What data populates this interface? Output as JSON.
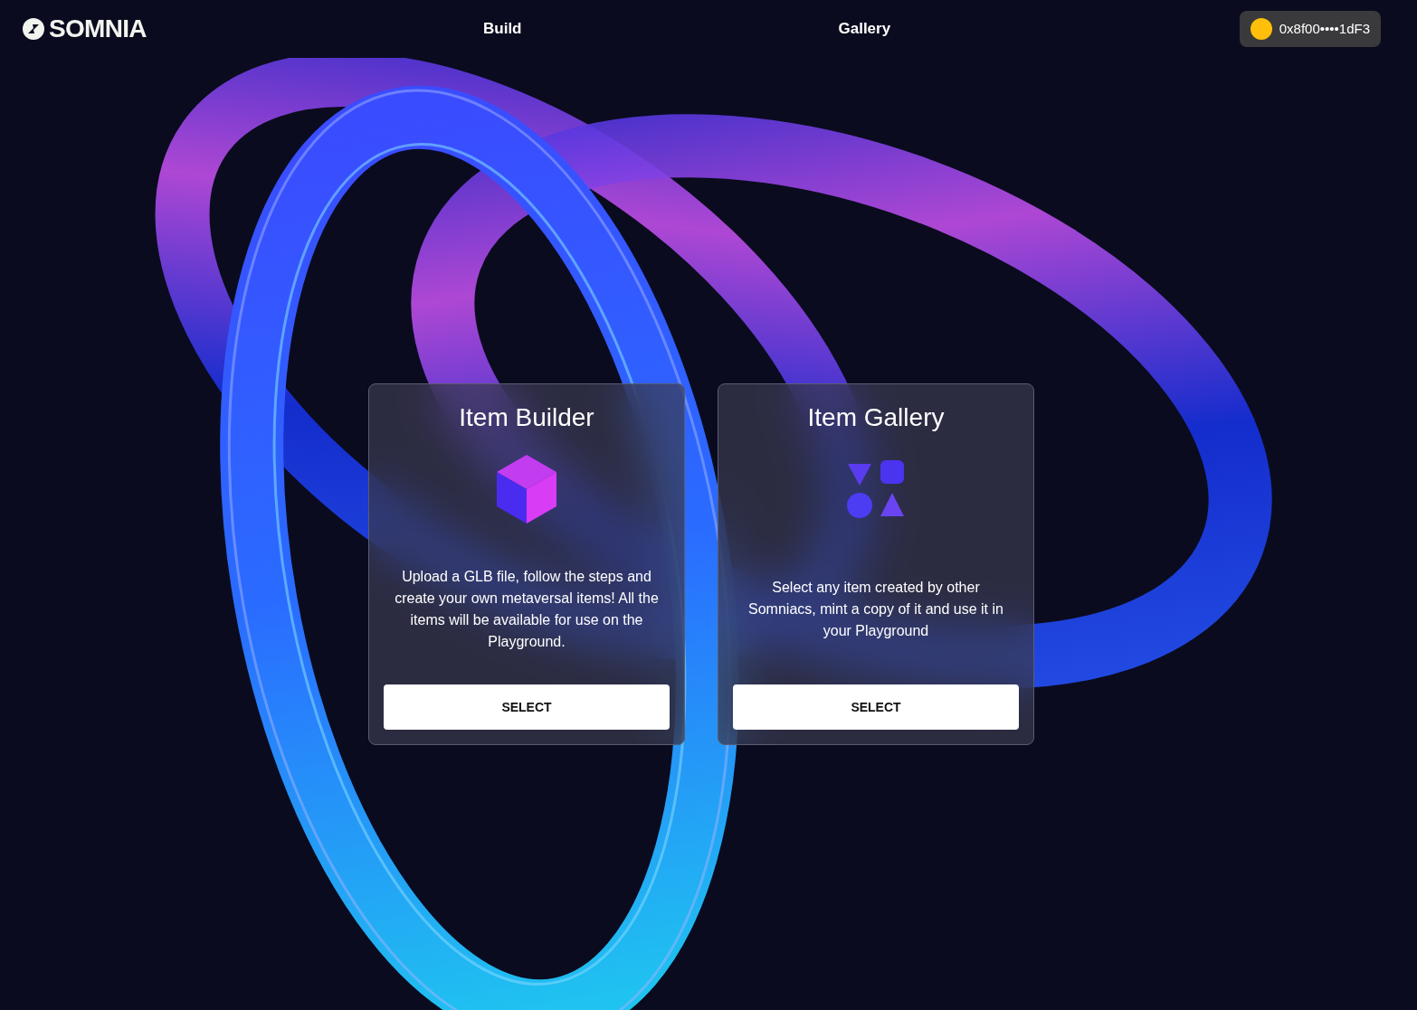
{
  "header": {
    "logo": "SOMNIA",
    "nav": [
      {
        "label": "Build"
      },
      {
        "label": "Gallery"
      }
    ],
    "wallet": {
      "address": "0x8f00••••1dF3"
    }
  },
  "cards": [
    {
      "kind": "cube",
      "title": "Item Builder",
      "description": "Upload a GLB file, follow the steps and create your own metaversal items! All the items will be available for use on the Playground.",
      "button": "SELECT"
    },
    {
      "kind": "shapes",
      "title": "Item Gallery",
      "description": "Select any item created by other Somniacs, mint a copy of it and use it in your Playground",
      "button": "SELECT"
    }
  ]
}
